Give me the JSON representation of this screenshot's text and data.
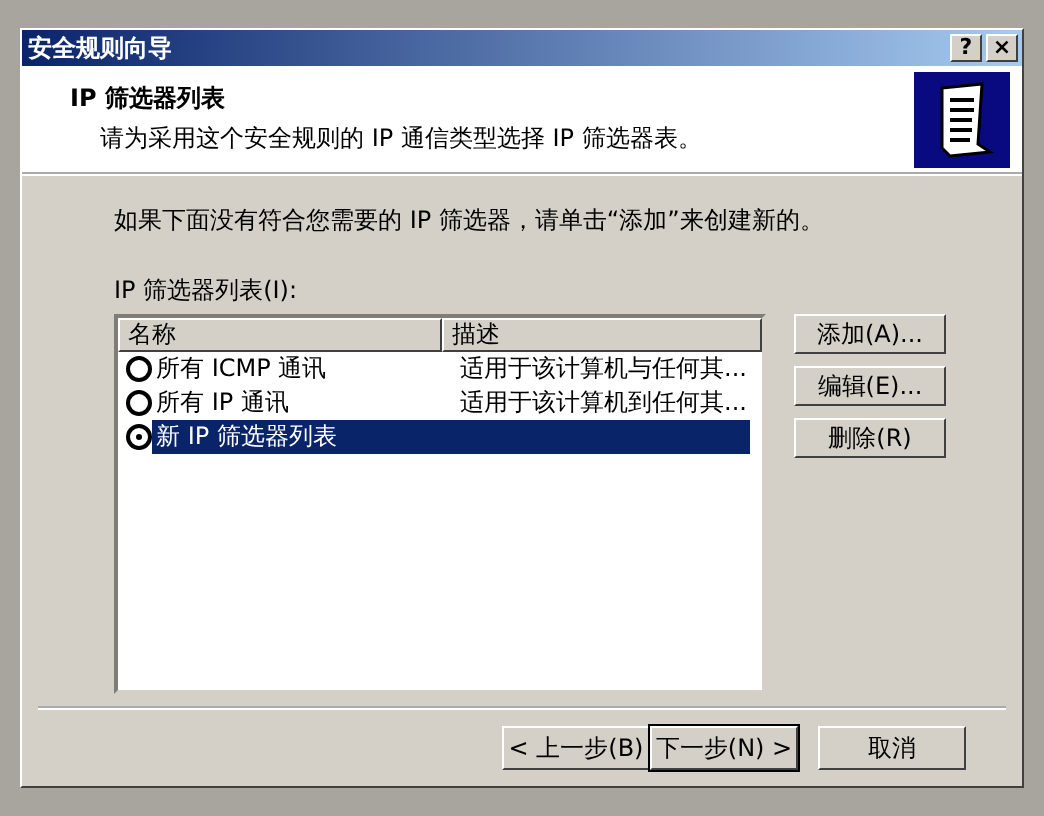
{
  "window": {
    "title": "安全规则向导",
    "title_buttons": [
      "?",
      "×"
    ]
  },
  "header": {
    "title": "IP 筛选器列表",
    "subtitle": "请为采用这个安全规则的 IP 通信类型选择 IP 筛选器表。"
  },
  "instruction": "如果下面没有符合您需要的 IP 筛选器，请单击“添加”来创建新的。",
  "list_label": "IP 筛选器列表(I):",
  "table": {
    "columns": [
      "名称",
      "描述"
    ],
    "rows": [
      {
        "name": "所有 ICMP 通讯",
        "description": "适用于该计算机与任何其...",
        "selected": false
      },
      {
        "name": "所有 IP 通讯",
        "description": "适用于该计算机到任何其...",
        "selected": false
      },
      {
        "name": "新 IP 筛选器列表",
        "description": "",
        "selected": true
      }
    ]
  },
  "side_buttons": [
    "添加(A)...",
    "编辑(E)...",
    "删除(R)"
  ],
  "footer_buttons": [
    "< 上一步(B)",
    "下一步(N) >",
    "取消"
  ]
}
